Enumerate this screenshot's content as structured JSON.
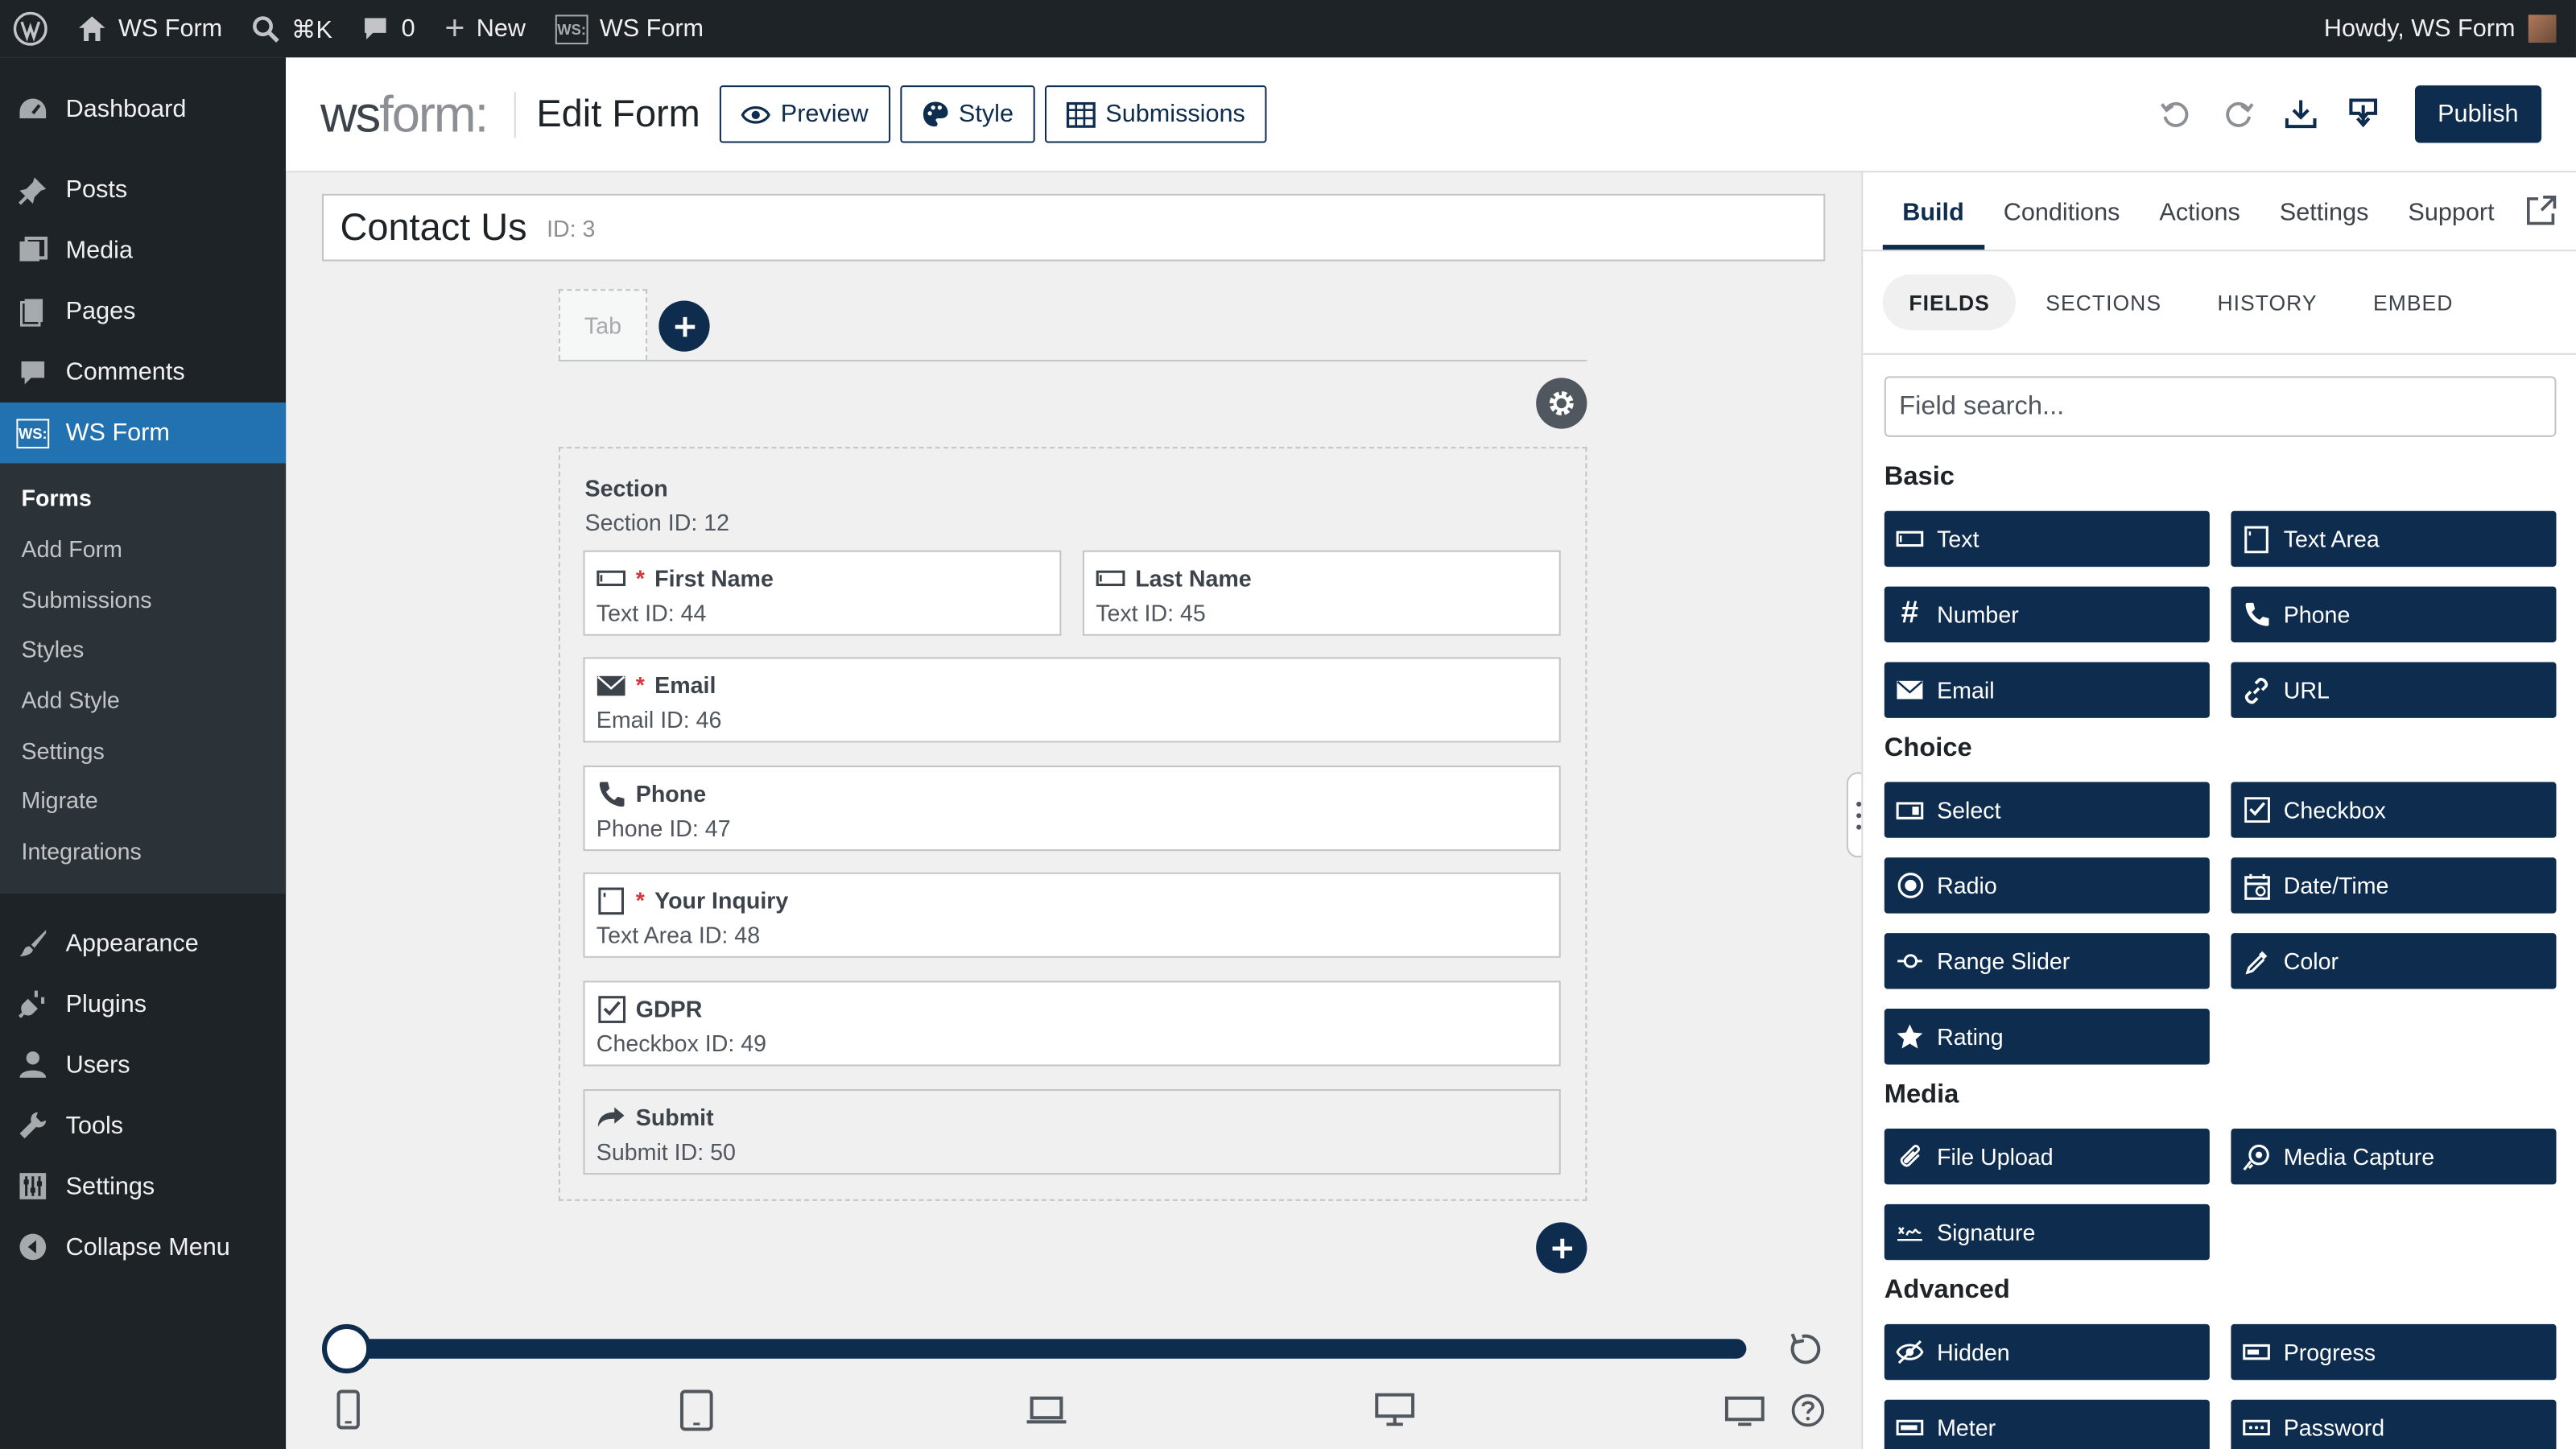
{
  "admin_bar": {
    "site": "WS Form",
    "shortcut": "⌘K",
    "comments_count": "0",
    "new_label": "New",
    "plugin": "WS Form",
    "plugin_badge": "WS:",
    "greeting": "Howdy, WS Form"
  },
  "sidebar": {
    "items_top": [
      {
        "label": "Dashboard",
        "icon": "dashboard-icon"
      },
      {
        "label": "Posts",
        "icon": "pin-icon"
      },
      {
        "label": "Media",
        "icon": "media-icon"
      },
      {
        "label": "Pages",
        "icon": "pages-icon"
      },
      {
        "label": "Comments",
        "icon": "comment-icon"
      },
      {
        "label": "WS Form",
        "icon": "wsform-icon"
      }
    ],
    "submenu": [
      "Forms",
      "Add Form",
      "Submissions",
      "Styles",
      "Add Style",
      "Settings",
      "Migrate",
      "Integrations"
    ],
    "items_bottom": [
      {
        "label": "Appearance",
        "icon": "brush-icon"
      },
      {
        "label": "Plugins",
        "icon": "plug-icon"
      },
      {
        "label": "Users",
        "icon": "user-icon"
      },
      {
        "label": "Tools",
        "icon": "wrench-icon"
      },
      {
        "label": "Settings",
        "icon": "sliders-icon"
      },
      {
        "label": "Collapse Menu",
        "icon": "collapse-icon"
      }
    ]
  },
  "header": {
    "logo_ws": "ws",
    "logo_form": "form",
    "logo_colon": ":",
    "title": "Edit Form",
    "preview": "Preview",
    "style": "Style",
    "submissions": "Submissions",
    "publish": "Publish"
  },
  "form": {
    "title": "Contact Us",
    "id_label": "ID: 3",
    "tab_label": "Tab",
    "section_label": "Section",
    "section_id": "Section  ID: 12",
    "fields": [
      {
        "label": "First Name",
        "meta": "Text  ID: 44",
        "required": "*",
        "icon": "text-icon"
      },
      {
        "label": "Last Name",
        "meta": "Text  ID: 45",
        "required": "",
        "icon": "text-icon"
      },
      {
        "label": "Email",
        "meta": "Email  ID: 46",
        "required": "*",
        "icon": "email-icon"
      },
      {
        "label": "Phone",
        "meta": "Phone  ID: 47",
        "required": "",
        "icon": "phone-icon"
      },
      {
        "label": "Your Inquiry",
        "meta": "Text Area  ID: 48",
        "required": "*",
        "icon": "textarea-icon"
      },
      {
        "label": "GDPR",
        "meta": "Checkbox  ID: 49",
        "required": "",
        "icon": "checkbox-icon"
      },
      {
        "label": "Submit",
        "meta": "Submit  ID: 50",
        "required": "",
        "icon": "submit-icon"
      }
    ],
    "breakpoint_slider": 0
  },
  "panel": {
    "tabs": [
      "Build",
      "Conditions",
      "Actions",
      "Settings",
      "Support"
    ],
    "active_tab": "Build",
    "subtabs": [
      "FIELDS",
      "SECTIONS",
      "HISTORY",
      "EMBED"
    ],
    "search_placeholder": "Field search...",
    "categories": [
      {
        "name": "Basic",
        "fields": [
          {
            "label": "Text",
            "icon": "text-icon"
          },
          {
            "label": "Text Area",
            "icon": "textarea-icon"
          },
          {
            "label": "Number",
            "icon": "hash-icon"
          },
          {
            "label": "Phone",
            "icon": "phone-icon"
          },
          {
            "label": "Email",
            "icon": "email-icon"
          },
          {
            "label": "URL",
            "icon": "link-icon"
          }
        ]
      },
      {
        "name": "Choice",
        "fields": [
          {
            "label": "Select",
            "icon": "select-icon"
          },
          {
            "label": "Checkbox",
            "icon": "checkbox-icon"
          },
          {
            "label": "Radio",
            "icon": "radio-icon"
          },
          {
            "label": "Date/Time",
            "icon": "calendar-icon"
          },
          {
            "label": "Range Slider",
            "icon": "range-icon"
          },
          {
            "label": "Color",
            "icon": "eyedropper-icon"
          },
          {
            "label": "Rating",
            "icon": "star-icon"
          }
        ]
      },
      {
        "name": "Media",
        "fields": [
          {
            "label": "File Upload",
            "icon": "paperclip-icon"
          },
          {
            "label": "Media Capture",
            "icon": "camera-icon"
          },
          {
            "label": "Signature",
            "icon": "signature-icon"
          }
        ]
      },
      {
        "name": "Advanced",
        "fields": [
          {
            "label": "Hidden",
            "icon": "hidden-icon"
          },
          {
            "label": "Progress",
            "icon": "progress-icon"
          },
          {
            "label": "Meter",
            "icon": "meter-icon"
          },
          {
            "label": "Password",
            "icon": "password-icon"
          }
        ]
      }
    ]
  },
  "colors": {
    "navy": "#0e2c4e",
    "wp_blue": "#2271b1",
    "admin_dark": "#1d2327"
  }
}
